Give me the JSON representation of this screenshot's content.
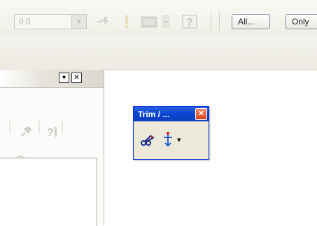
{
  "toolbar": {
    "combo_value": "0.0",
    "all_button": "All...",
    "only_button": "Only"
  },
  "panel": {
    "dropdown_glyph": "▾",
    "close_glyph": "✕"
  },
  "trim_window": {
    "title": "Trim / ...",
    "close_glyph": "✕",
    "dropdown_glyph": "▾"
  },
  "icons": [
    "lightning-icon",
    "exclamation-icon",
    "image-icon",
    "question-icon",
    "scissors-icon",
    "trim-extend-icon",
    "pin-icon",
    "target-icon"
  ]
}
